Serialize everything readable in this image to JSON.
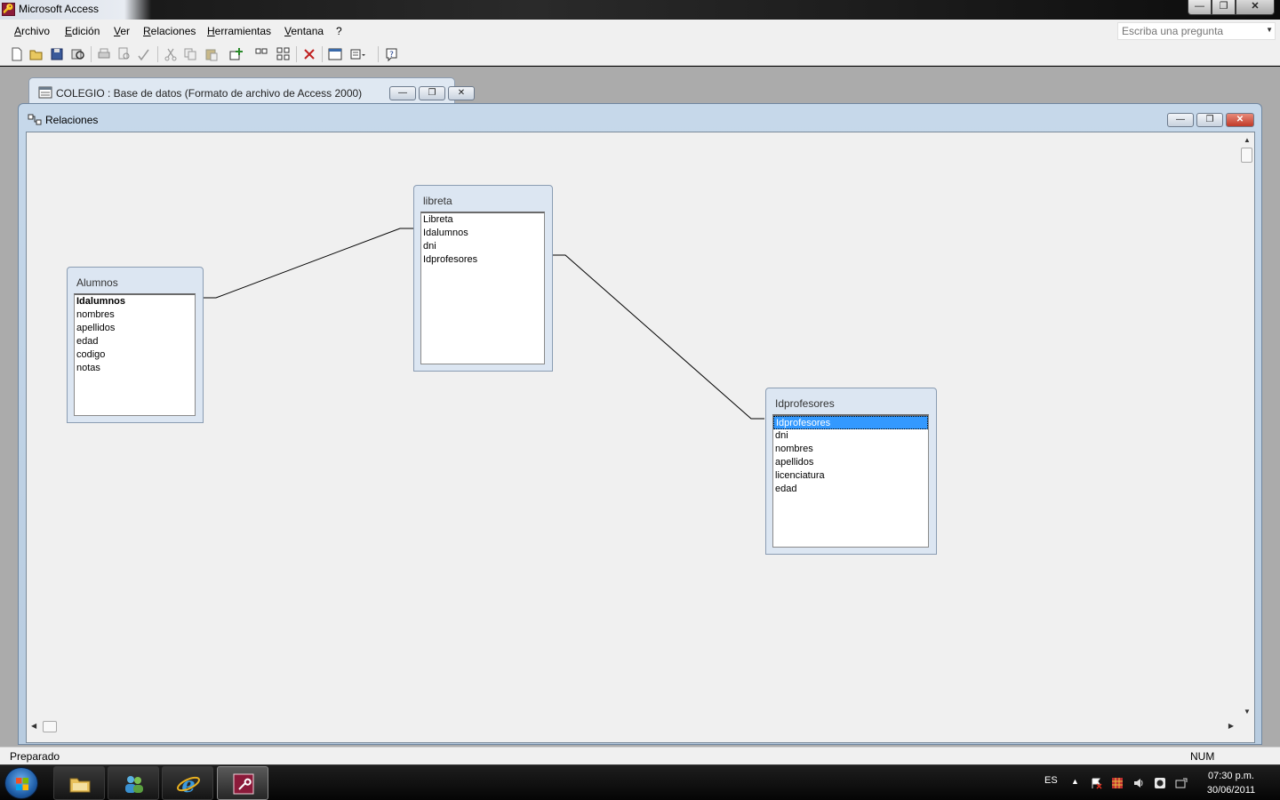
{
  "app": {
    "title": "Microsoft Access",
    "window_buttons": {
      "minimize": "—",
      "restore": "❐",
      "close": "✕"
    }
  },
  "menu": {
    "items": [
      "Archivo",
      "Edición",
      "Ver",
      "Relaciones",
      "Herramientas",
      "Ventana",
      "?"
    ]
  },
  "ask_box": {
    "placeholder": "Escriba una pregunta"
  },
  "toolbar": {
    "icons": [
      "new-icon",
      "open-icon",
      "save-icon",
      "search-icon",
      "print-icon",
      "print-preview-icon",
      "spelling-icon",
      "cut-icon",
      "copy-icon",
      "paste-icon",
      "show-table-icon",
      "show-direct-icon",
      "show-all-icon",
      "delete-icon",
      "database-window-icon",
      "new-object-icon",
      "help-icon"
    ]
  },
  "db_window": {
    "title": "COLEGIO : Base de datos (Formato de archivo de Access 2000)"
  },
  "relations_window": {
    "title": "Relaciones"
  },
  "tables": [
    {
      "name": "Alumnos",
      "fields": [
        "Idalumnos",
        "nombres",
        "apellidos",
        "edad",
        "codigo",
        "notas"
      ],
      "primary_key": "Idalumnos",
      "selected": ""
    },
    {
      "name": "libreta",
      "fields": [
        "Libreta",
        "Idalumnos",
        "dni",
        "Idprofesores"
      ],
      "primary_key": "",
      "selected": ""
    },
    {
      "name": "Idprofesores",
      "fields": [
        "Idprofesores",
        "dni",
        "nombres",
        "apellidos",
        "licenciatura",
        "edad"
      ],
      "primary_key": "",
      "selected": "Idprofesores"
    }
  ],
  "relationships": [
    {
      "from_table": "Alumnos",
      "from_field": "Idalumnos",
      "to_table": "libreta",
      "to_field": "Idalumnos"
    },
    {
      "from_table": "libreta",
      "from_field": "Idprofesores",
      "to_table": "Idprofesores",
      "to_field": "Idprofesores"
    }
  ],
  "status": {
    "text": "Preparado",
    "num": "NUM"
  },
  "taskbar": {
    "language": "ES",
    "time": "07:30 p.m.",
    "date": "30/06/2011",
    "pinned": [
      "explorer-icon",
      "messenger-icon",
      "internet-explorer-icon",
      "access-icon"
    ]
  },
  "colors": {
    "selection": "#3399ff",
    "access_brand": "#8b1a3a"
  }
}
